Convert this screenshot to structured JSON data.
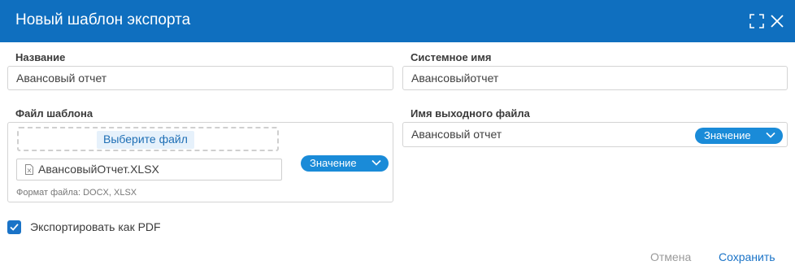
{
  "dialog": {
    "title": "Новый шаблон экспорта",
    "maximize_icon": "maximize-icon",
    "close_icon": "close-icon"
  },
  "fields": {
    "name": {
      "label": "Название",
      "value": "Авансовый отчет"
    },
    "system_name": {
      "label": "Системное имя",
      "value": "Авансовыйотчет"
    },
    "template_file": {
      "label": "Файл шаблона",
      "choose_label": "Выберите файл",
      "file_name": "АвансовыйОтчет.XLSX",
      "file_icon": "excel-file-icon",
      "format_hint": "Формат файла: DOCX, XLSX",
      "value_button": "Значение"
    },
    "output_file": {
      "label": "Имя выходного файла",
      "value": "Авансовый отчет",
      "value_button": "Значение"
    }
  },
  "export_pdf": {
    "label": "Экспортировать как PDF",
    "checked": true
  },
  "footer": {
    "cancel_label": "Отмена",
    "save_label": "Сохранить"
  },
  "colors": {
    "header": "#0f6fbf",
    "accent": "#1a8bd8",
    "save": "#1a73c7"
  }
}
